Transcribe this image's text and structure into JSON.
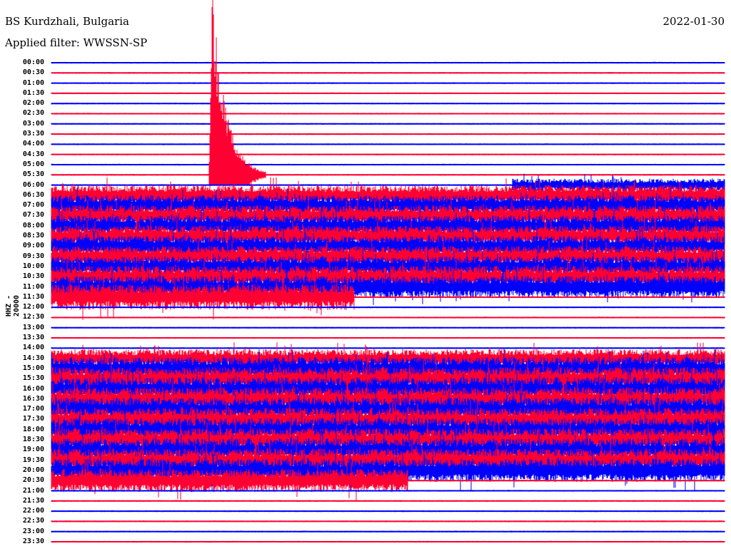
{
  "header": {
    "station": "BS Kurdzhali, Bulgaria",
    "filter": "Applied filter: WWSSN-SP",
    "date": "2022-01-30"
  },
  "chart_data": {
    "type": "line",
    "title": "BS Kurdzhali, Bulgaria",
    "subtitle": "Applied filter: WWSSN-SP",
    "date": "2022-01-30",
    "ylabel": "HHZ - 20000",
    "xlabel": "",
    "row_minutes": 30,
    "colors": {
      "even": "#0000ff",
      "odd": "#ff0033"
    },
    "tick_labels": [
      "00:00",
      "00:30",
      "01:00",
      "01:30",
      "02:00",
      "02:30",
      "03:00",
      "03:30",
      "04:00",
      "04:30",
      "05:00",
      "05:30",
      "06:00",
      "06:30",
      "07:00",
      "07:30",
      "08:00",
      "08:30",
      "09:00",
      "09:30",
      "10:00",
      "10:30",
      "11:00",
      "11:30",
      "12:00",
      "12:30",
      "13:00",
      "13:30",
      "14:00",
      "14:30",
      "15:00",
      "15:30",
      "16:00",
      "16:30",
      "17:00",
      "17:30",
      "18:00",
      "18:30",
      "19:00",
      "19:30",
      "20:00",
      "20:30",
      "21:00",
      "21:30",
      "22:00",
      "22:30",
      "23:00",
      "23:30"
    ],
    "noise_segments": [
      {
        "row": 12,
        "from": 0.685,
        "to": 1.0,
        "amp": 0.5
      },
      {
        "row": 13,
        "from": 0.0,
        "to": 1.0,
        "amp": 0.8
      },
      {
        "row": 14,
        "from": 0.0,
        "to": 1.0,
        "amp": 0.8
      },
      {
        "row": 15,
        "from": 0.0,
        "to": 1.0,
        "amp": 0.8
      },
      {
        "row": 16,
        "from": 0.0,
        "to": 1.0,
        "amp": 0.8
      },
      {
        "row": 17,
        "from": 0.0,
        "to": 1.0,
        "amp": 0.8
      },
      {
        "row": 18,
        "from": 0.0,
        "to": 1.0,
        "amp": 0.8
      },
      {
        "row": 19,
        "from": 0.0,
        "to": 1.0,
        "amp": 0.8
      },
      {
        "row": 20,
        "from": 0.0,
        "to": 1.0,
        "amp": 0.8
      },
      {
        "row": 21,
        "from": 0.0,
        "to": 1.0,
        "amp": 0.85
      },
      {
        "row": 22,
        "from": 0.0,
        "to": 1.0,
        "amp": 0.85
      },
      {
        "row": 23,
        "from": 0.0,
        "to": 0.45,
        "amp": 1.0
      },
      {
        "row": 29,
        "from": 0.0,
        "to": 1.0,
        "amp": 0.7
      },
      {
        "row": 30,
        "from": 0.0,
        "to": 1.0,
        "amp": 0.9
      },
      {
        "row": 31,
        "from": 0.0,
        "to": 1.0,
        "amp": 0.9
      },
      {
        "row": 32,
        "from": 0.0,
        "to": 1.0,
        "amp": 0.9
      },
      {
        "row": 33,
        "from": 0.0,
        "to": 1.0,
        "amp": 0.9
      },
      {
        "row": 34,
        "from": 0.0,
        "to": 1.0,
        "amp": 0.9
      },
      {
        "row": 35,
        "from": 0.0,
        "to": 1.0,
        "amp": 0.9
      },
      {
        "row": 36,
        "from": 0.0,
        "to": 1.0,
        "amp": 0.9
      },
      {
        "row": 37,
        "from": 0.0,
        "to": 1.0,
        "amp": 0.9
      },
      {
        "row": 38,
        "from": 0.0,
        "to": 1.0,
        "amp": 0.9
      },
      {
        "row": 39,
        "from": 0.0,
        "to": 1.0,
        "amp": 0.9
      },
      {
        "row": 40,
        "from": 0.0,
        "to": 1.0,
        "amp": 0.9
      },
      {
        "row": 41,
        "from": 0.0,
        "to": 0.53,
        "amp": 0.9
      }
    ],
    "events": [
      {
        "row": 11,
        "at": 0.239,
        "amp": 20,
        "decay": 0.08
      }
    ]
  }
}
